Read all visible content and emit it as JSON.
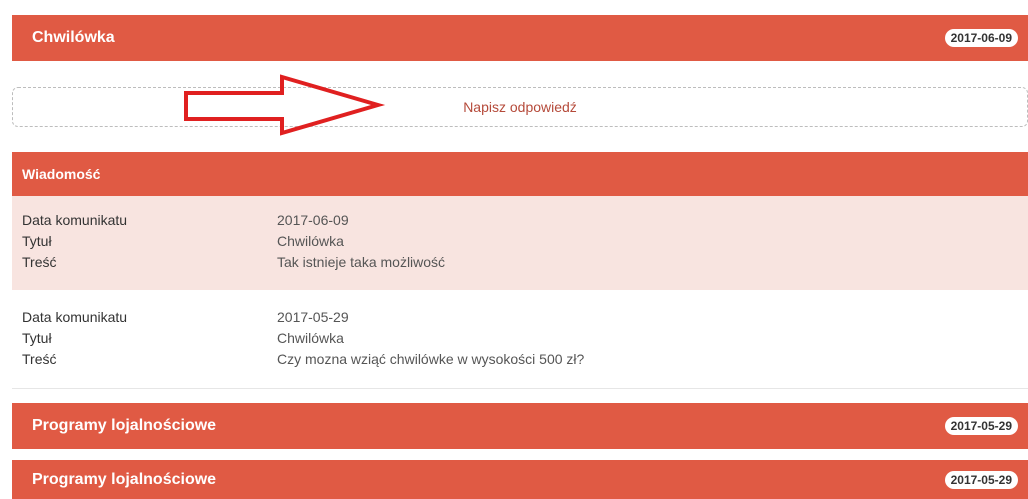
{
  "threads": [
    {
      "title": "Chwilówka",
      "date": "2017-06-09"
    },
    {
      "title": "Programy lojalnościowe",
      "date": "2017-05-29"
    },
    {
      "title": "Programy lojalnościowe",
      "date": "2017-05-29"
    }
  ],
  "reply": {
    "label": "Napisz odpowiedź"
  },
  "messages_section": {
    "title": "Wiadomość"
  },
  "messages": [
    {
      "fields": [
        {
          "key": "Data komunikatu",
          "value": "2017-06-09"
        },
        {
          "key": "Tytuł",
          "value": "Chwilówka"
        },
        {
          "key": "Treść",
          "value": "Tak istnieje taka możliwość"
        }
      ]
    },
    {
      "fields": [
        {
          "key": "Data komunikatu",
          "value": "2017-05-29"
        },
        {
          "key": "Tytuł",
          "value": "Chwilówka"
        },
        {
          "key": "Treść",
          "value": "Czy mozna wziąć chwilówke w wysokości 500 zł?"
        }
      ]
    }
  ],
  "colors": {
    "accent": "#e05a44",
    "highlight_row": "#f8e4e0",
    "annotation_arrow": "#e02020"
  }
}
